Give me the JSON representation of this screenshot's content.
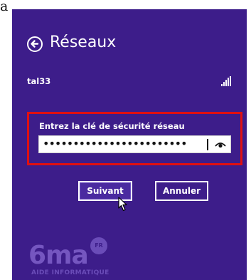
{
  "tab_fragment": "a",
  "header": {
    "back_icon": "back-arrow-circle-icon",
    "title": "Réseaux"
  },
  "network": {
    "name": "tal33",
    "signal_icon": "signal-strength-icon"
  },
  "security_key": {
    "label": "Entrez la clé de sécurité réseau",
    "value": "••••••••••••••••••••••••",
    "reveal_icon": "eye-icon"
  },
  "buttons": {
    "next_label": "Suivant",
    "cancel_label": "Annuler"
  },
  "watermark": {
    "logo": "6ma",
    "badge": "FR",
    "tagline": "AIDE INFORMATIQUE"
  },
  "colors": {
    "panel_background": "#3d1d8a",
    "highlight_border": "#e01010",
    "text": "#ffffff"
  }
}
